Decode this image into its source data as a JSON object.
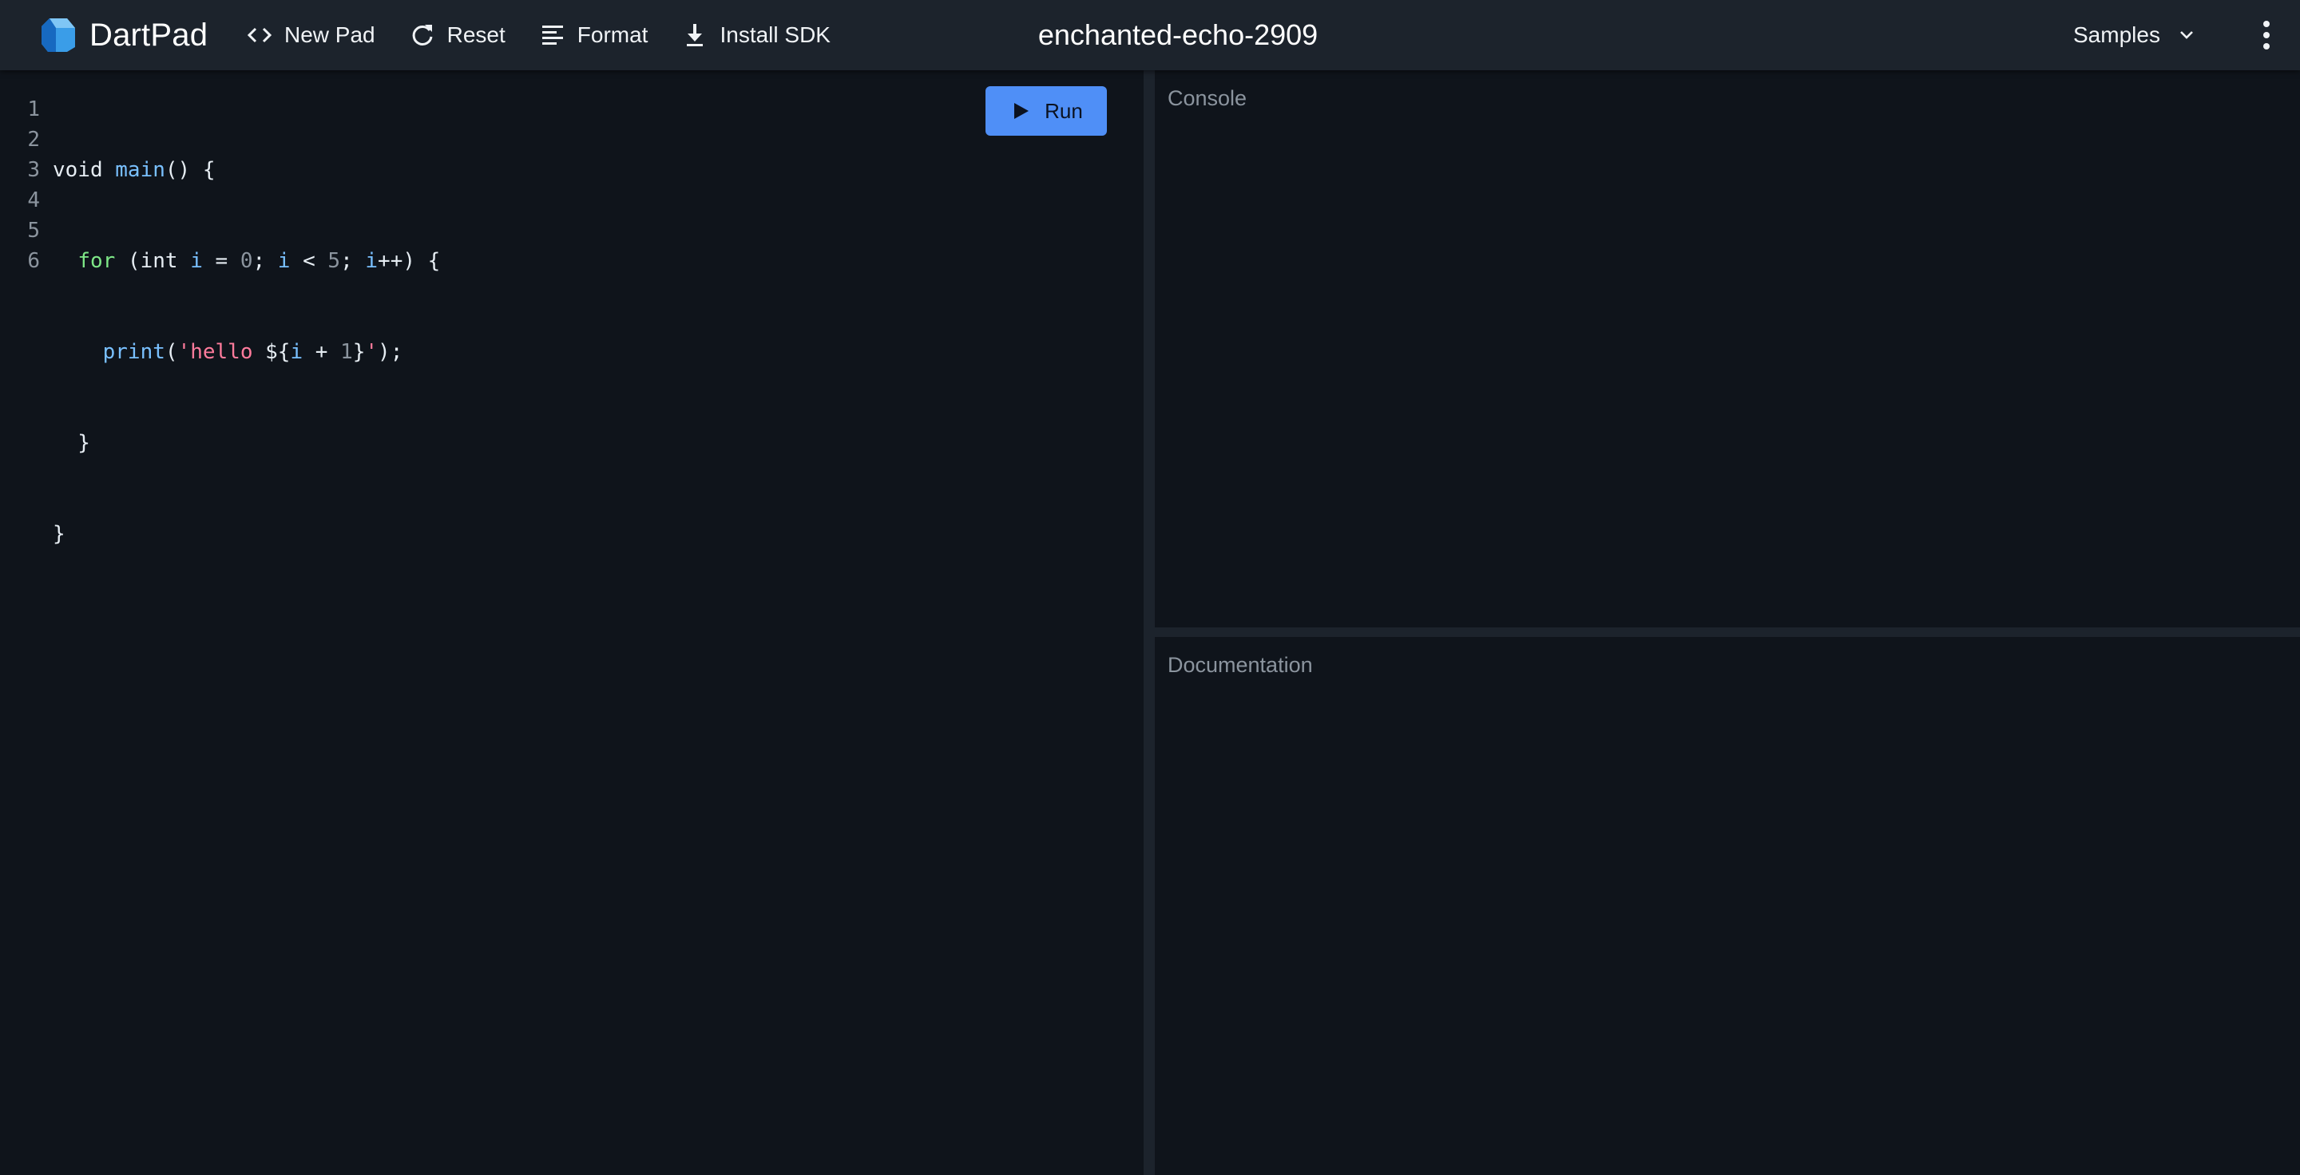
{
  "app": {
    "name": "DartPad",
    "pad_title": "enchanted-echo-2909"
  },
  "toolbar": {
    "new_pad_label": "New Pad",
    "reset_label": "Reset",
    "format_label": "Format",
    "install_sdk_label": "Install SDK",
    "samples_label": "Samples"
  },
  "editor": {
    "line_numbers": [
      "1",
      "2",
      "3",
      "4",
      "5",
      "6"
    ],
    "run_label": "Run"
  },
  "panels": {
    "console_title": "Console",
    "documentation_title": "Documentation"
  },
  "icons": {
    "logo": "dart-logo-icon",
    "new_pad": "code-brackets-icon",
    "reset": "refresh-icon",
    "format": "format-lines-icon",
    "install_sdk": "download-icon",
    "samples": "chevron-down-icon",
    "more": "more-vert-icon",
    "run": "play-icon"
  },
  "colors": {
    "accent": "#4f8ff7",
    "topbar": "#1c232c",
    "background": "#0f141b"
  }
}
